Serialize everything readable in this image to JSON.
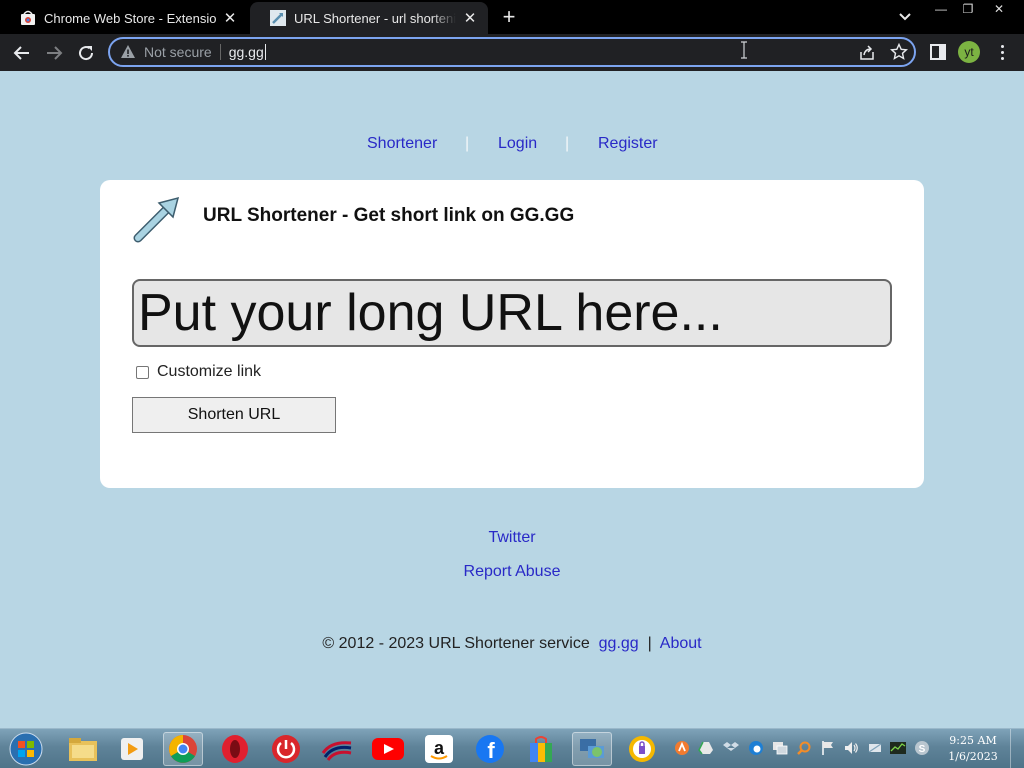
{
  "browser": {
    "tabs": [
      {
        "title": "Chrome Web Store - Extensions",
        "close": "✕"
      },
      {
        "title": "URL Shortener - url shortening service",
        "close": "✕"
      }
    ],
    "new_tab": "+",
    "window_controls": {
      "minimize": "—",
      "maximize": "❐",
      "close": "✕"
    },
    "address_bar": {
      "security_label": "Not secure",
      "url": "gg.gg"
    },
    "profile_initials": "yt"
  },
  "page": {
    "nav": {
      "shortener": "Shortener",
      "login": "Login",
      "register": "Register",
      "separator": "|"
    },
    "title": "URL Shortener - Get short link on GG.GG",
    "url_input_placeholder": "Put your long URL here...",
    "customize_label": "Customize link",
    "shorten_button": "Shorten URL",
    "footer": {
      "twitter": "Twitter",
      "report_abuse": "Report Abuse",
      "copyright": "© 2012 - 2023 URL Shortener service",
      "site_link": "gg.gg",
      "separator": "|",
      "about": "About"
    }
  },
  "taskbar": {
    "apps": [
      "windows-explorer",
      "media-player",
      "chrome",
      "opera",
      "power",
      "bank-of-america",
      "youtube",
      "amazon",
      "facebook",
      "shopping-bag",
      "network-tool",
      "vpn"
    ],
    "clock": {
      "time": "9:25 AM",
      "date": "1/6/2023"
    }
  },
  "colors": {
    "page_bg": "#b8d6e4",
    "link": "#2929c7",
    "chrome_dark": "#202124",
    "omnibox_focus": "#7ca4f0"
  }
}
